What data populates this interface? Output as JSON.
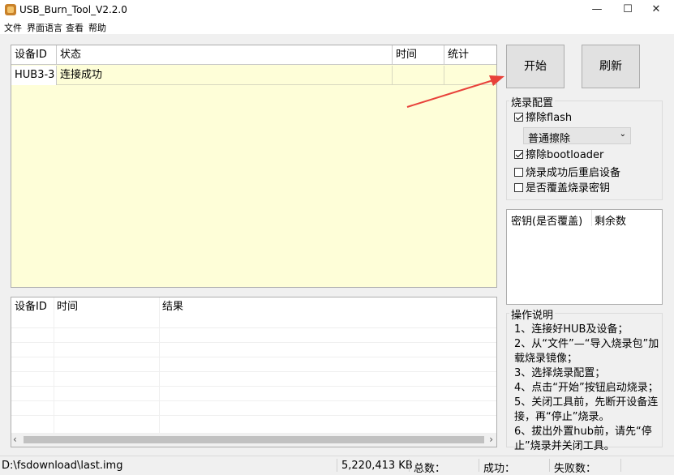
{
  "window": {
    "title": "USB_Burn_Tool_V2.2.0",
    "minimize": "—",
    "maximize": "☐",
    "close": "✕"
  },
  "menu": [
    "文件",
    "界面语言",
    "查看",
    "帮助"
  ],
  "device_list": {
    "columns": [
      "设备ID",
      "状态",
      "时间",
      "统计"
    ],
    "rows": [
      {
        "id": "HUB3-3",
        "status": "连接成功",
        "time": "",
        "stats": ""
      }
    ]
  },
  "result_list": {
    "columns": [
      "设备ID",
      "时间",
      "结果"
    ],
    "scroll_left": "‹",
    "scroll_right": "›"
  },
  "buttons": {
    "start": "开始",
    "refresh": "刷新"
  },
  "burn_config": {
    "title": "烧录配置",
    "erase_flash": {
      "label": "擦除flash",
      "checked": true
    },
    "erase_mode": "普通擦除",
    "erase_mode_arrow": "⌄",
    "erase_bootloader": {
      "label": "擦除bootloader",
      "checked": true
    },
    "reboot_after": {
      "label": "烧录成功后重启设备",
      "checked": false
    },
    "overwrite_key": {
      "label": "是否覆盖烧录密钥",
      "checked": false
    }
  },
  "key_list": {
    "columns": [
      "密钥(是否覆盖)",
      "剩余数"
    ]
  },
  "instructions": {
    "title": "操作说明",
    "text": "1、连接好HUB及设备；\n2、从“文件”—“导入烧录包”加载烧录镜像；\n3、选择烧录配置；\n4、点击“开始”按钮启动烧录；\n5、关闭工具前，先断开设备连接，再“停止”烧录。\n6、拔出外置hub前，请先“停止”烧录并关闭工具。"
  },
  "status_bar": {
    "path": "D:\\fsdownload\\last.img",
    "size": "5,220,413 KB",
    "total": "总数：",
    "success": "成功：",
    "fail": "失败数："
  },
  "colors": {
    "list_bg": "#fefed8",
    "annotation_arrow": "#e8413a"
  }
}
